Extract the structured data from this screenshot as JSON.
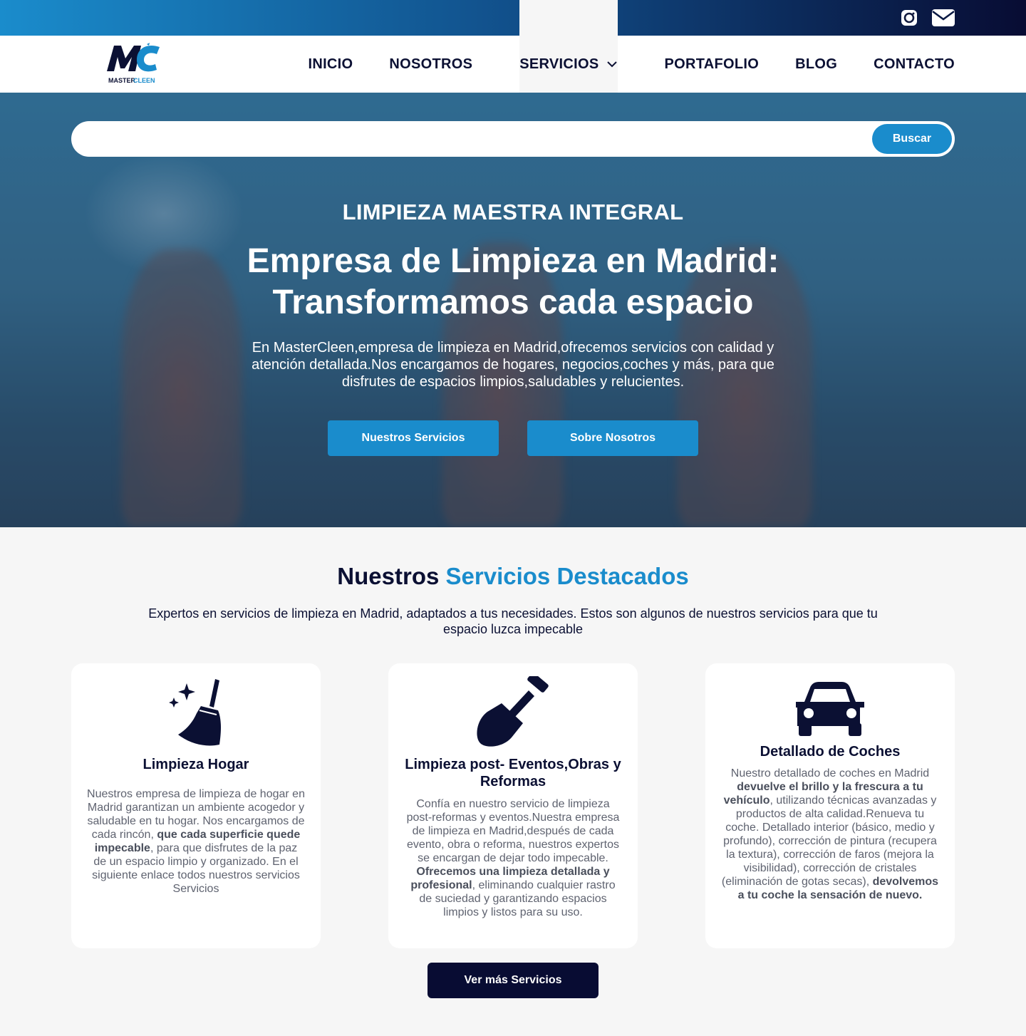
{
  "topbar": {
    "icons": [
      "instagram-icon",
      "mail-icon"
    ],
    "gradient": [
      "#1a8ccc",
      "#080c33"
    ]
  },
  "brand": {
    "logo_letters": "MC",
    "logo_text": "MASTER CLEEN"
  },
  "nav": {
    "items": [
      "INICIO",
      "NOSOTROS",
      "SERVICIOS",
      "PORTAFOLIO",
      "BLOG",
      "CONTACTO"
    ]
  },
  "search": {
    "value": "",
    "button_label": "Buscar"
  },
  "hero": {
    "kicker": "LIMPIEZA MAESTRA INTEGRAL",
    "headline_line1": "Empresa de Limpieza en Madrid:",
    "headline_line2": "Transformamos cada espacio",
    "lead": "En MasterCleen,empresa de limpieza en Madrid,ofrecemos servicios con calidad y atención detallada.Nos encargamos de hogares, negocios,coches y más, para que disfrutes de espacios limpios,saludables y relucientes.",
    "cta_primary": "Nuestros Servicios",
    "cta_secondary": "Sobre Nosotros"
  },
  "services": {
    "title_part1": "Nuestros",
    "title_part2": "Servicios Destacados",
    "subtitle": "Expertos en servicios de limpieza en Madrid, adaptados a tus necesidades. Estos son algunos de nuestros servicios para que tu espacio luzca impecable",
    "cards": [
      {
        "icon": "broom-sparkle-icon",
        "title": "Limpieza Hogar",
        "text_a": "Nuestros empresa de limpieza de hogar en Madrid garantizan un ambiente acogedor y saludable en tu hogar. Nos encargamos de cada rincón, ",
        "text_b": "que cada superficie quede impecable",
        "text_c": ", para que disfrutes de la paz de un espacio limpio y organizado. En el siguiente enlace todos nuestros servicios Servicios"
      },
      {
        "icon": "shovel-icon",
        "title": "Limpieza post- Eventos,Obras y Reformas",
        "text_a": "Confía en nuestro servicio de limpieza post-reformas y eventos.Nuestra empresa de limpieza en Madrid,después de cada evento, obra o reforma, nuestros expertos se encargan de dejar todo impecable. ",
        "text_b": "Ofrecemos una limpieza detallada y profesional",
        "text_c": ", eliminando cualquier rastro de suciedad y garantizando espacios limpios y listos para su uso."
      },
      {
        "icon": "car-icon",
        "title": "Detallado de Coches",
        "text_a": "Nuestro detallado de coches en Madrid ",
        "text_b": "devuelve el brillo y la frescura a tu vehículo",
        "text_c": ", utilizando técnicas avanzadas y productos de alta calidad.Renueva tu coche. Detallado interior (básico, medio y profundo), corrección de pintura (recupera la textura), corrección de faros (mejora la visibilidad), corrección de cristales (eliminación de gotas secas), ",
        "text_d": "devolvemos a tu coche la sensación de nuevo."
      }
    ],
    "more_button": "Ver más Servicios"
  },
  "colors": {
    "accent": "#1a8ccc",
    "navy": "#080c33",
    "text": "#0b1033"
  }
}
